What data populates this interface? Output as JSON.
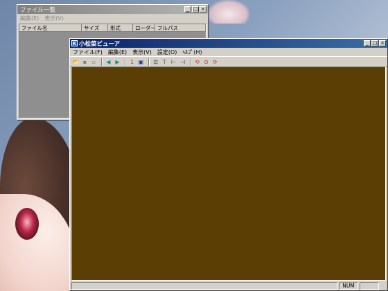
{
  "desktop": {},
  "filelist_window": {
    "title": "ファイル一覧",
    "menu": [
      "編集(E)",
      "表示(V)"
    ],
    "columns": [
      "ファイル名",
      "サイズ",
      "形式",
      "ローダー",
      "フルパス"
    ],
    "controls": {
      "minimize": "_",
      "maximize": "□",
      "close": "×"
    }
  },
  "viewer_window": {
    "title": "小松菜ビューア",
    "app_icon": "K",
    "menu": [
      "ファイル(F)",
      "編集(E)",
      "表示(V)",
      "設定(O)",
      "ﾍﾙﾌﾟ(H)"
    ],
    "controls": {
      "minimize": "_",
      "maximize": "□",
      "close": "×"
    },
    "toolbar": [
      {
        "name": "open-folder-icon",
        "glyph": "📂",
        "color": "#c8a020"
      },
      {
        "name": "save-icon",
        "glyph": "▪",
        "color": "#808080"
      },
      {
        "name": "copy-icon",
        "glyph": "▫",
        "color": "#808080"
      },
      {
        "name": "back-arrow-icon",
        "glyph": "◀",
        "color": "#1a8a8a"
      },
      {
        "name": "forward-arrow-icon",
        "glyph": "▶",
        "color": "#1a8a8a"
      },
      {
        "name": "actual-size-icon",
        "glyph": "1",
        "color": "#b03020"
      },
      {
        "name": "fit-window-icon",
        "glyph": "▣",
        "color": "#20408a"
      },
      {
        "name": "zoom-fit-icon",
        "glyph": "⊡",
        "color": "#303030"
      },
      {
        "name": "zoom-width-icon",
        "glyph": "⊤",
        "color": "#303030"
      },
      {
        "name": "zoom-height-icon",
        "glyph": "⊢",
        "color": "#303030"
      },
      {
        "name": "zoom-custom-icon",
        "glyph": "⊣",
        "color": "#303030"
      },
      {
        "name": "rotate-left-icon",
        "glyph": "⟲",
        "color": "#b03020"
      },
      {
        "name": "rotate-icon",
        "glyph": "⊙",
        "color": "#b03020"
      },
      {
        "name": "rotate-right-icon",
        "glyph": "⟳",
        "color": "#b03020"
      }
    ],
    "canvas_color": "#5a3e03",
    "status": {
      "num": "NUM"
    }
  }
}
